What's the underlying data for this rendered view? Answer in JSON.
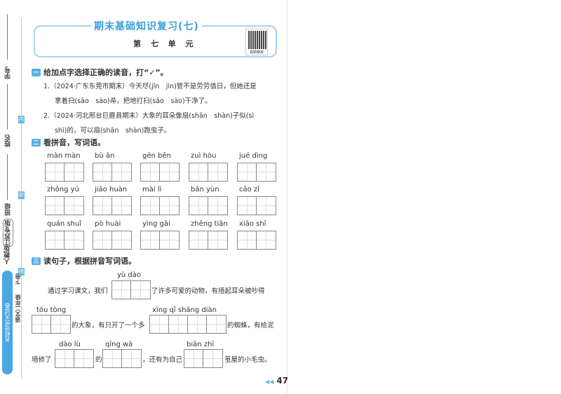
{
  "side": {
    "student_id": "学号",
    "name": "姓名",
    "class": "班级",
    "edition": "江苏专版",
    "publisher": "人教版",
    "volume": "下册",
    "subject": "语文二年级",
    "brand": "名校培优大试卷",
    "marks": [
      "内",
      "封",
      "线"
    ]
  },
  "header": {
    "title": "期末基础知识复习(七)",
    "unit": "第 七 单 元",
    "qr_label": "视频精讲"
  },
  "section1": {
    "num": "一",
    "title": "给加点字选择正确的读音，打“✓”。",
    "q1a": "1.（2024·广东东莞市期末）今天尽(jǐn　jìn)管不是劳劳值日，但她还是",
    "q1b": "拿着扫(sǎo　sào)帚，把地打扫(sǎo　sào)干净了。",
    "q2a": "2.（2024·河北邢台巨鹿县期末）大象的耳朵像扇(shān　shàn)子似(sì",
    "q2b": "shì)的，可以扇(shān　shàn)跑虫子。"
  },
  "section2": {
    "num": "二",
    "title": "看拼音，写词语。",
    "items": [
      "màn màn",
      "bù ān",
      "gēn běn",
      "zuì hòu",
      "jué dìng",
      "zhōng yú",
      "jiāo huàn",
      "mài lì",
      "bān yùn",
      "cǎo zǐ",
      "quán shuǐ",
      "pò huài",
      "yìng gāi",
      "zhěng tiān",
      "xiāo shī"
    ]
  },
  "section3": {
    "num": "三",
    "title": "读句子，根据拼音写词语。",
    "t1": "通过学习课文，我们",
    "p1": "yù dào",
    "t2": "了许多可爱的动物，有捂起耳朵被吵得",
    "p2": "tóu tòng",
    "t3": "的大象，有只开了一个多",
    "p3": "xīng qī shāng diàn",
    "t4": "的蜘蛛，有给泥",
    "t5": "墙修了",
    "p4": "dào lù",
    "t6": "的",
    "p5": "qīng wā",
    "t7": "，还有为自己",
    "p6": "biān zhī",
    "t8": "茧屋的小毛虫。"
  },
  "page_number": "47"
}
